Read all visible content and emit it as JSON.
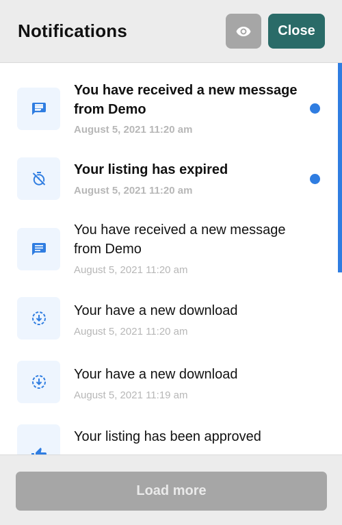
{
  "header": {
    "title": "Notifications",
    "eye_icon": "eye-icon",
    "close_label": "Close"
  },
  "notifications": [
    {
      "icon": "message-icon",
      "title": "You have received a new message from Demo",
      "time": "August 5, 2021 11:20 am",
      "unread": true
    },
    {
      "icon": "timer-off-icon",
      "title": "Your listing has expired",
      "time": "August 5, 2021 11:20 am",
      "unread": true
    },
    {
      "icon": "message-icon",
      "title": "You have received a new message from Demo",
      "time": "August 5, 2021 11:20 am",
      "unread": false
    },
    {
      "icon": "download-icon",
      "title": "Your have a new download",
      "time": "August 5, 2021 11:20 am",
      "unread": false
    },
    {
      "icon": "download-icon",
      "title": "Your have a new download",
      "time": "August 5, 2021 11:19 am",
      "unread": false
    },
    {
      "icon": "thumbs-up-icon",
      "title": "Your listing has been approved",
      "time": "",
      "unread": false
    }
  ],
  "footer": {
    "load_more_label": "Load more"
  },
  "colors": {
    "accent": "#2f7de1",
    "close_button": "#2a6b68",
    "disabled_button": "#a6a6a6",
    "icon_tile": "#eef5fe"
  }
}
